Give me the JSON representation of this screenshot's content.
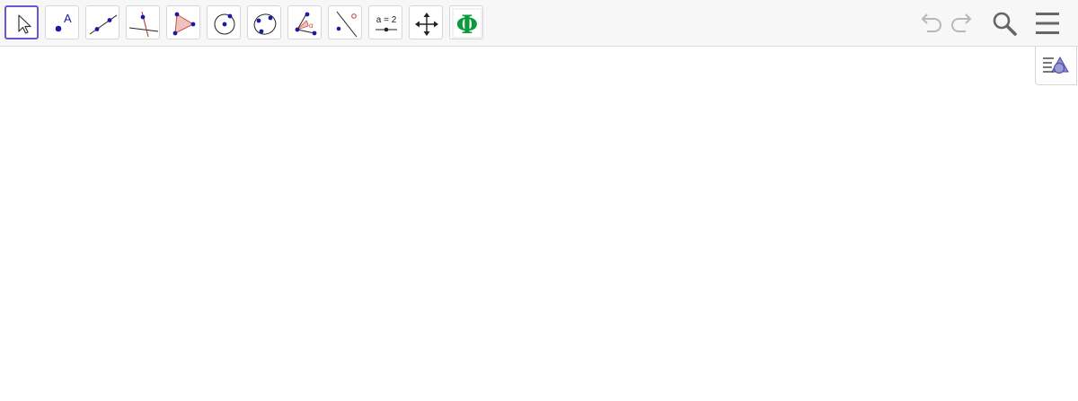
{
  "toolbar": {
    "tools": [
      {
        "name": "move-tool-button",
        "icon": "arrow-pointer-icon"
      },
      {
        "name": "point-tool-button",
        "icon": "point-icon",
        "label": "A"
      },
      {
        "name": "line-tool-button",
        "icon": "line-through-two-points-icon"
      },
      {
        "name": "perpendicular-line-tool-button",
        "icon": "perpendicular-line-icon"
      },
      {
        "name": "polygon-tool-button",
        "icon": "polygon-icon"
      },
      {
        "name": "circle-center-point-tool-button",
        "icon": "circle-with-center-icon"
      },
      {
        "name": "circle-three-points-tool-button",
        "icon": "circle-through-three-points-icon"
      },
      {
        "name": "angle-tool-button",
        "icon": "angle-icon",
        "label": "α"
      },
      {
        "name": "reflect-about-line-tool-button",
        "icon": "reflect-icon"
      },
      {
        "name": "slider-tool-button",
        "icon": "slider-icon",
        "label": "a = 2"
      },
      {
        "name": "move-graphics-view-tool-button",
        "icon": "move-view-icon"
      },
      {
        "name": "custom-tool-button",
        "icon": "phi-icon",
        "label": "Φ"
      }
    ],
    "right": {
      "undo_icon": "undo-icon",
      "redo_icon": "redo-icon",
      "search_icon": "search-icon",
      "menu_icon": "hamburger-menu-icon"
    }
  },
  "algebra_toggle": {
    "icon": "algebra-view-toggle-icon"
  },
  "colors": {
    "selected_border": "#6557d2",
    "point_blue": "#1a1aa6",
    "polygon_fill": "#f1c1bd",
    "polygon_stroke": "#c8504a",
    "phi_green": "#0a9b3c",
    "disabled_gray": "#b8b8b8",
    "icon_gray": "#666666"
  }
}
